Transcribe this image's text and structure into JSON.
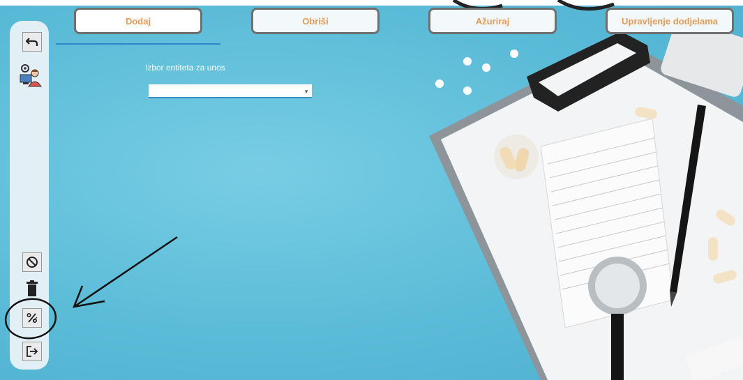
{
  "tabs": [
    {
      "label": "Dodaj"
    },
    {
      "label": "Obriši"
    },
    {
      "label": "Ažuriraj"
    },
    {
      "label": "Upravljenje dodjelama"
    }
  ],
  "form": {
    "entity_label": "Izbor entiteta za unos",
    "entity_select_value": ""
  },
  "sidebar": {
    "icons": [
      "undo-icon",
      "admin-user-icon",
      "cancel-icon",
      "trash-icon",
      "percent-edit-icon",
      "logout-icon"
    ]
  },
  "colors": {
    "background": "#5bbcd8",
    "tab_text": "#e89a56",
    "tab_border": "#6f6f6f",
    "underline": "#2f87cc",
    "sidebar": "#e2f0f6"
  }
}
